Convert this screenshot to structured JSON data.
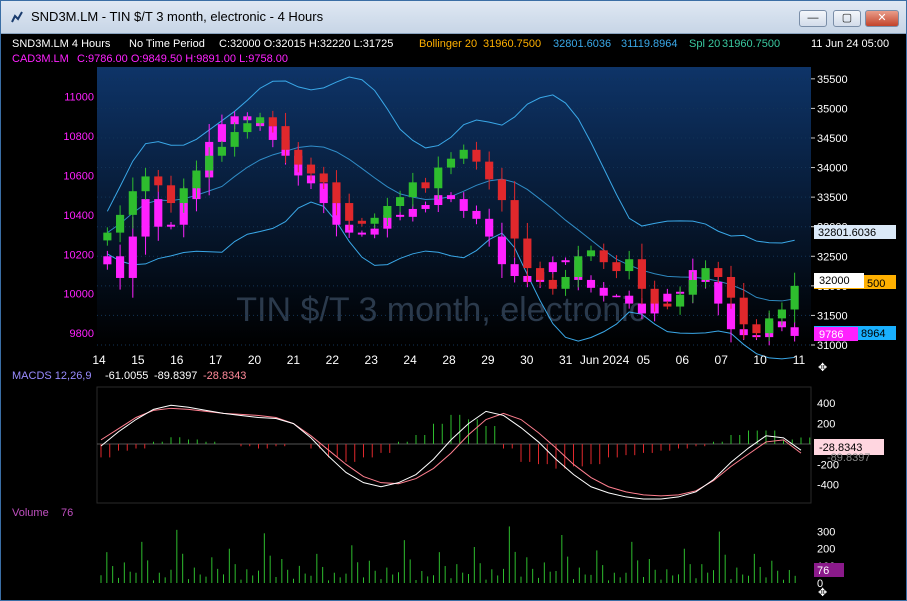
{
  "window": {
    "title": "SND3M.LM - TIN $/T 3 month, electronic - 4 Hours",
    "buttons": {
      "minimize": "—",
      "maximize": "▢",
      "close": "✕"
    }
  },
  "header": {
    "symbol": "SND3M.LM 4 Hours",
    "period": "No Time Period",
    "ohlc": "C:32000 O:32015 H:32220 L:31725",
    "bollinger_label": "Bollinger 20",
    "bollinger_mid": "31960.7500",
    "bollinger_upper": "32801.6036",
    "bollinger_lower": "31119.8964",
    "spl_label": "Spl 20",
    "spl_value": "31960.7500",
    "datetime": "11 Jun 24 05:00",
    "overlay_symbol": "CAD3M.LM",
    "overlay_ohlc": "C:9786.00 O:9849.50 H:9891.00 L:9758.00",
    "watermark": "TIN $/T 3 month, electronic"
  },
  "price_axis": {
    "right_ticks": [
      "35500",
      "35000",
      "34500",
      "34000",
      "33500",
      "33000",
      "32500",
      "32000",
      "31500",
      "31000"
    ],
    "left_ticks": [
      "11000",
      "10800",
      "10600",
      "10400",
      "10200",
      "10000",
      "9800"
    ],
    "tags": {
      "upper": "32801.6036",
      "close": "32000",
      "mid": "500",
      "lower": "8964",
      "overlay": "9786"
    }
  },
  "date_axis": [
    "14",
    "15",
    "16",
    "17",
    "20",
    "21",
    "22",
    "23",
    "24",
    "28",
    "29",
    "30",
    "31",
    "Jun 2024",
    "05",
    "06",
    "07",
    "10",
    "11"
  ],
  "macd": {
    "label": "MACDS 12,26,9",
    "v1": "-61.0055",
    "v2": "-89.8397",
    "v3": "-28.8343",
    "ticks": [
      "400",
      "200",
      "0",
      "-200",
      "-400"
    ],
    "tag": "-28.8343",
    "tag2": "-89.8397"
  },
  "volume": {
    "label": "Volume",
    "value": "76",
    "ticks": [
      "300",
      "200",
      "100",
      "0"
    ],
    "tag": "76"
  },
  "colors": {
    "up": "#2ebd2e",
    "down": "#e0282c",
    "overlay": "#ff21ff",
    "band": "#3aa8e8",
    "panel_top": "#0e3468",
    "panel_bottom": "#000000"
  },
  "chart_data": {
    "type": "candlestick",
    "primary_series": "SND3M.LM",
    "secondary_series": "CAD3M.LM",
    "y_right_range": [
      31000,
      35700
    ],
    "y_left_range": [
      9740,
      11150
    ],
    "primary_close": [
      32900,
      33200,
      33600,
      33850,
      33700,
      33400,
      33650,
      33950,
      34200,
      34350,
      34600,
      34750,
      34850,
      34700,
      34300,
      34050,
      33900,
      33750,
      33400,
      33100,
      33050,
      33150,
      33350,
      33500,
      33750,
      33650,
      34000,
      34150,
      34300,
      34100,
      33800,
      33450,
      32800,
      32300,
      32100,
      31950,
      32150,
      32500,
      32600,
      32400,
      32250,
      32450,
      31950,
      31700,
      31650,
      31850,
      32100,
      32300,
      32150,
      31800,
      31350,
      31200,
      31450,
      31600,
      32000
    ],
    "overlay_close": [
      10190,
      10080,
      10290,
      10480,
      10340,
      10350,
      10480,
      10590,
      10770,
      10860,
      10900,
      10880,
      10850,
      10780,
      10700,
      10600,
      10560,
      10460,
      10350,
      10310,
      10300,
      10330,
      10400,
      10390,
      10430,
      10450,
      10500,
      10480,
      10420,
      10380,
      10290,
      10150,
      10090,
      10060,
      10110,
      10160,
      10170,
      10070,
      10030,
      9990,
      9990,
      9950,
      9900,
      9960,
      10000,
      10010,
      10120,
      10060,
      9950,
      9820,
      9790,
      9780,
      9860,
      9830,
      9786
    ],
    "macd_line": [
      -20,
      120,
      240,
      340,
      380,
      360,
      330,
      300,
      280,
      260,
      250,
      200,
      60,
      -120,
      -280,
      -380,
      -420,
      -380,
      -300,
      -150,
      40,
      200,
      320,
      280,
      160,
      20,
      -150,
      -300,
      -420,
      -480,
      -520,
      -540,
      -540,
      -520,
      -470,
      -350,
      -180,
      -40,
      80,
      60,
      -61
    ],
    "signal_line": [
      40,
      150,
      260,
      330,
      350,
      340,
      320,
      300,
      290,
      280,
      260,
      200,
      80,
      -60,
      -200,
      -320,
      -380,
      -390,
      -340,
      -240,
      -90,
      90,
      240,
      300,
      240,
      110,
      -40,
      -200,
      -330,
      -420,
      -470,
      -500,
      -510,
      -500,
      -460,
      -360,
      -220,
      -100,
      20,
      40,
      -89.8
    ],
    "volume": [
      180,
      120,
      240,
      60,
      310,
      90,
      150,
      200,
      80,
      290,
      140,
      100,
      170,
      60,
      220,
      130,
      90,
      250,
      70,
      180,
      110,
      210,
      80,
      330,
      150,
      120,
      280,
      90,
      190,
      60,
      240,
      140,
      80,
      200,
      110,
      300,
      90,
      170,
      130,
      76
    ]
  }
}
